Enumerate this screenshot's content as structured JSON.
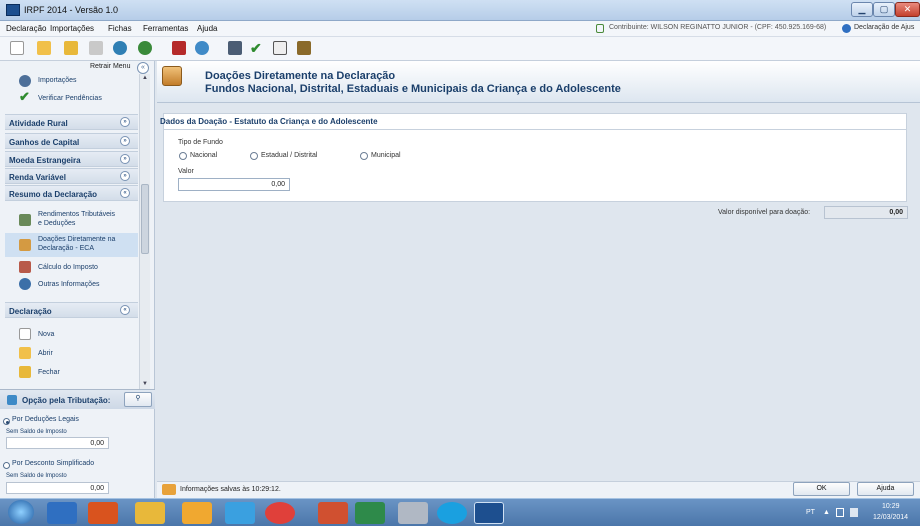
{
  "window": {
    "title": "IRPF 2014 - Versão 1.0",
    "min_glyph": "▁",
    "max_glyph": "▢",
    "close_glyph": "✕"
  },
  "menu": {
    "items": [
      "Declaração",
      "Importações",
      "Fichas",
      "Ferramentas",
      "Ajuda"
    ],
    "contribuinte": "Contribuinte: WILSON REGINATTO JUNIOR - (CPF: 450.925.169-68)",
    "declaracao_ajuste": "Declaração de Ajus"
  },
  "toolbar": {
    "icons": [
      "new-icon",
      "open-icon",
      "folder-icon",
      "trash-icon",
      "sync-icon",
      "network-icon",
      "save-icon",
      "globe-icon",
      "print-icon",
      "check-icon",
      "document-icon",
      "book-icon"
    ]
  },
  "sidebar": {
    "retrair": "Retrair Menu",
    "retrair_glyph": "«",
    "top_items": [
      {
        "label": "Importações"
      },
      {
        "label": "Verificar Pendências"
      }
    ],
    "sections": [
      {
        "label": "Atividade Rural",
        "glyph": "»"
      },
      {
        "label": "Ganhos de Capital",
        "glyph": "»"
      },
      {
        "label": "Moeda Estrangeira",
        "glyph": "»"
      },
      {
        "label": "Renda Variável",
        "glyph": "»"
      },
      {
        "label": "Resumo da Declaração",
        "glyph": "«"
      }
    ],
    "resumo_items": [
      {
        "label1": "Rendimentos Tributáveis",
        "label2": "e Deduções"
      },
      {
        "label1": "Doações Diretamente na",
        "label2": "Declaração - ECA"
      },
      {
        "label1": "Cálculo do Imposto",
        "label2": ""
      },
      {
        "label1": "Outras Informações",
        "label2": ""
      }
    ],
    "declaracao": {
      "label": "Declaração",
      "glyph": "«",
      "items": [
        "Nova",
        "Abrir",
        "Fechar"
      ]
    },
    "scroll_up": "▲",
    "scroll_down": "▼"
  },
  "opcao": {
    "title": "Opção pela Tributação:",
    "search_glyph": "⚲",
    "deducoes_label": "Por Deduções Legais",
    "deducoes_sub": "Sem Saldo de Imposto",
    "deducoes_value": "0,00",
    "simplificado_label": "Por Desconto Simplificado",
    "simplificado_sub": "Sem Saldo de Imposto",
    "simplificado_value": "0,00"
  },
  "main": {
    "title": "Doações Diretamente na Declaração",
    "subtitle": "Fundos Nacional, Distrital, Estaduais e Municipais da Criança e do Adolescente",
    "form_title": "Dados da Doação - Estatuto da Criança e do Adolescente",
    "tipo_label": "Tipo de Fundo",
    "radios": [
      "Nacional",
      "Estadual / Distrital",
      "Municipal"
    ],
    "valor_label": "Valor",
    "valor_value": "0,00",
    "disp_label": "Valor disponível para doação:",
    "disp_value": "0,00"
  },
  "status": {
    "saved": "Informações salvas às 10:29:12.",
    "ok": "OK",
    "ajuda": "Ajuda"
  },
  "taskbar": {
    "lang": "PT",
    "tray_up": "▲",
    "time": "10:29",
    "date": "12/03/2014"
  }
}
